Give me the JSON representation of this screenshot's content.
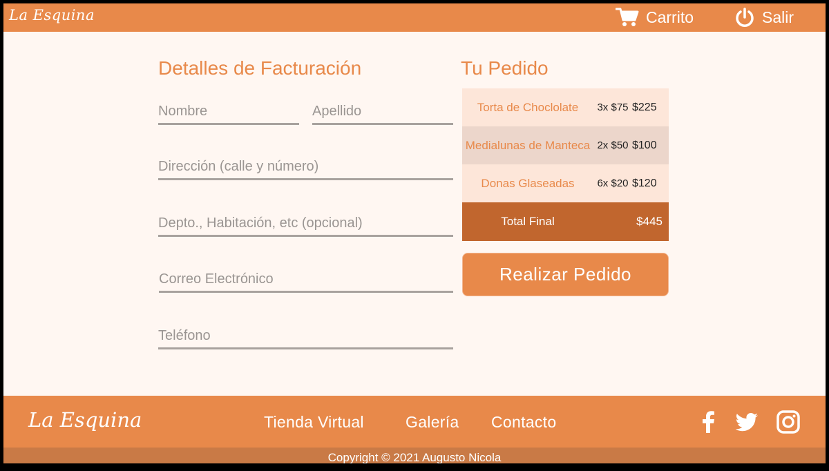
{
  "header": {
    "logo": "La Esquina",
    "cart_label": "Carrito",
    "logout_label": "Salir"
  },
  "billing": {
    "title": "Detalles de Facturación",
    "fields": {
      "first_name": "Nombre",
      "last_name": "Apellido",
      "address": "Dirección (calle y número)",
      "apartment": "Depto., Habitación, etc (opcional)",
      "email": "Correo Electrónico",
      "phone": "Teléfono"
    }
  },
  "order": {
    "title": "Tu Pedido",
    "items": [
      {
        "name": "Torta de Choclolate",
        "qty": "3x $75",
        "subtotal": "$225"
      },
      {
        "name": "Medialunas de Manteca",
        "qty": "2x $50",
        "subtotal": "$100"
      },
      {
        "name": "Donas Glaseadas",
        "qty": "6x $20",
        "subtotal": "$120"
      }
    ],
    "total_label": "Total Final",
    "total_value": "$445",
    "submit_label": "Realizar Pedido"
  },
  "footer": {
    "logo": "La Esquina",
    "links": [
      "Tienda Virtual",
      "Galería",
      "Contacto"
    ],
    "social_icons": [
      "facebook-icon",
      "twitter-icon",
      "instagram-icon"
    ],
    "copyright": "Copyright © 2021 Augusto Nicola"
  },
  "colors": {
    "accent": "#e8894a",
    "accent_dark": "#c1662e",
    "background": "#fff7f2",
    "row_light": "#fde6d9",
    "row_mid": "#ecd6cb"
  }
}
